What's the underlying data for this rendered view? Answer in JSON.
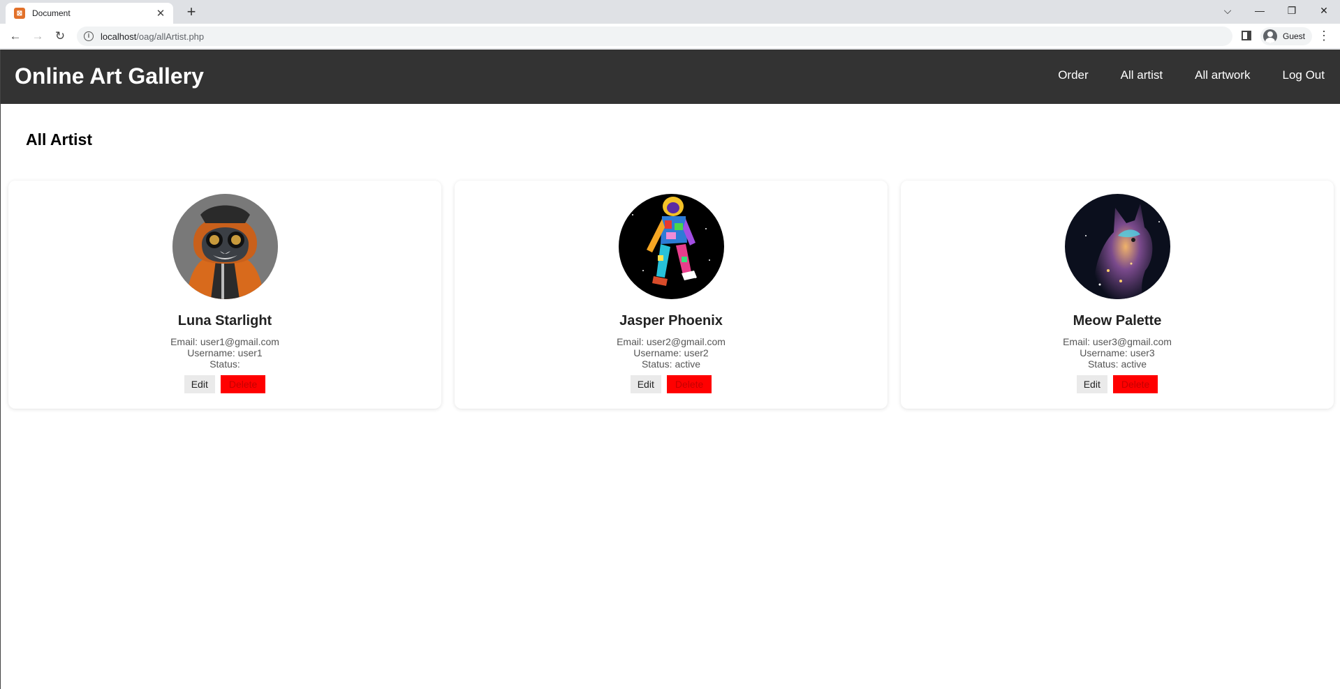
{
  "browser": {
    "tab_title": "Document",
    "url_host": "localhost",
    "url_path": "/oag/allArtist.php",
    "profile_label": "Guest"
  },
  "header": {
    "site_title": "Online Art Gallery",
    "nav": [
      {
        "label": "Order"
      },
      {
        "label": "All artist"
      },
      {
        "label": "All artwork"
      },
      {
        "label": "Log Out"
      }
    ]
  },
  "main": {
    "heading": "All Artist",
    "artists": [
      {
        "name": "Luna Starlight",
        "email": "Email: user1@gmail.com",
        "username": "Username: user1",
        "status": "Status:",
        "edit_label": "Edit",
        "delete_label": "Delete"
      },
      {
        "name": "Jasper Phoenix",
        "email": "Email: user2@gmail.com",
        "username": "Username: user2",
        "status": "Status: active",
        "edit_label": "Edit",
        "delete_label": "Delete"
      },
      {
        "name": "Meow Palette",
        "email": "Email: user3@gmail.com",
        "username": "Username: user3",
        "status": "Status: active",
        "edit_label": "Edit",
        "delete_label": "Delete"
      }
    ]
  },
  "colors": {
    "header_bg": "#333333",
    "delete_bg": "#ff0000",
    "edit_bg": "#eaeaea"
  }
}
